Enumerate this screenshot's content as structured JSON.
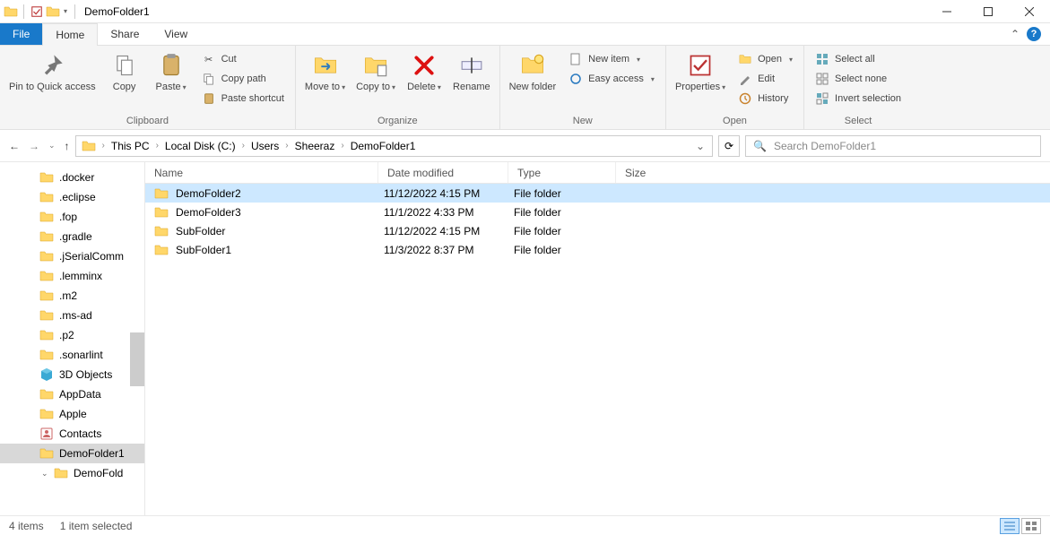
{
  "title": "DemoFolder1",
  "tabs": {
    "file": "File",
    "home": "Home",
    "share": "Share",
    "view": "View"
  },
  "ribbon": {
    "clipboard": {
      "label": "Clipboard",
      "pin": "Pin to Quick access",
      "copy": "Copy",
      "paste": "Paste",
      "cut": "Cut",
      "copy_path": "Copy path",
      "paste_shortcut": "Paste shortcut"
    },
    "organize": {
      "label": "Organize",
      "move_to": "Move to",
      "copy_to": "Copy to",
      "delete": "Delete",
      "rename": "Rename"
    },
    "new": {
      "label": "New",
      "new_folder": "New folder",
      "new_item": "New item",
      "easy_access": "Easy access"
    },
    "open": {
      "label": "Open",
      "properties": "Properties",
      "open": "Open",
      "edit": "Edit",
      "history": "History"
    },
    "select": {
      "label": "Select",
      "select_all": "Select all",
      "select_none": "Select none",
      "invert": "Invert selection"
    }
  },
  "breadcrumbs": [
    "This PC",
    "Local Disk (C:)",
    "Users",
    "Sheeraz",
    "DemoFolder1"
  ],
  "search": {
    "placeholder": "Search DemoFolder1"
  },
  "sidebar": {
    "items": [
      {
        "label": ".docker",
        "icon": "folder"
      },
      {
        "label": ".eclipse",
        "icon": "folder"
      },
      {
        "label": ".fop",
        "icon": "folder"
      },
      {
        "label": ".gradle",
        "icon": "folder"
      },
      {
        "label": ".jSerialComm",
        "icon": "folder"
      },
      {
        "label": ".lemminx",
        "icon": "folder"
      },
      {
        "label": ".m2",
        "icon": "folder"
      },
      {
        "label": ".ms-ad",
        "icon": "folder"
      },
      {
        "label": ".p2",
        "icon": "folder"
      },
      {
        "label": ".sonarlint",
        "icon": "folder"
      },
      {
        "label": "3D Objects",
        "icon": "cube"
      },
      {
        "label": "AppData",
        "icon": "folder"
      },
      {
        "label": "Apple",
        "icon": "folder"
      },
      {
        "label": "Contacts",
        "icon": "contacts"
      },
      {
        "label": "DemoFolder1",
        "icon": "folder",
        "selected": true
      },
      {
        "label": "DemoFold",
        "icon": "folder",
        "level": 2,
        "expand": true
      }
    ]
  },
  "columns": {
    "name": "Name",
    "date": "Date modified",
    "type": "Type",
    "size": "Size"
  },
  "files": [
    {
      "name": "DemoFolder2",
      "date": "11/12/2022 4:15 PM",
      "type": "File folder",
      "selected": true
    },
    {
      "name": "DemoFolder3",
      "date": "11/1/2022 4:33 PM",
      "type": "File folder"
    },
    {
      "name": "SubFolder",
      "date": "11/12/2022 4:15 PM",
      "type": "File folder"
    },
    {
      "name": "SubFolder1",
      "date": "11/3/2022 8:37 PM",
      "type": "File folder"
    }
  ],
  "status": {
    "count": "4 items",
    "selected": "1 item selected"
  }
}
